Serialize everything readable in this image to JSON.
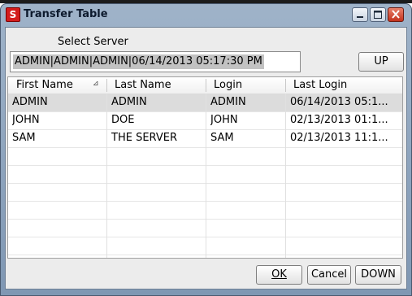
{
  "window": {
    "title": "Transfer Table",
    "app_icon_letter": "S"
  },
  "server": {
    "label": "Select Server",
    "value": "ADMIN|ADMIN|ADMIN|06/14/2013 05:17:30 PM"
  },
  "buttons": {
    "up": "UP",
    "ok": "OK",
    "cancel": "Cancel",
    "down": "DOWN"
  },
  "table": {
    "columns": [
      "First Name",
      "Last Name",
      "Login",
      "Last Login"
    ],
    "rows": [
      [
        "ADMIN",
        "ADMIN",
        "ADMIN",
        "06/14/2013 05:1..."
      ],
      [
        "JOHN",
        "DOE",
        "JOHN",
        "02/13/2013 01:1..."
      ],
      [
        "SAM",
        "THE SERVER",
        "SAM",
        "02/13/2013 11:1..."
      ]
    ]
  },
  "colors": {
    "selected_row": "#dcdcdc",
    "app_icon": "#d41c1c",
    "close_button": "#c3321d"
  }
}
